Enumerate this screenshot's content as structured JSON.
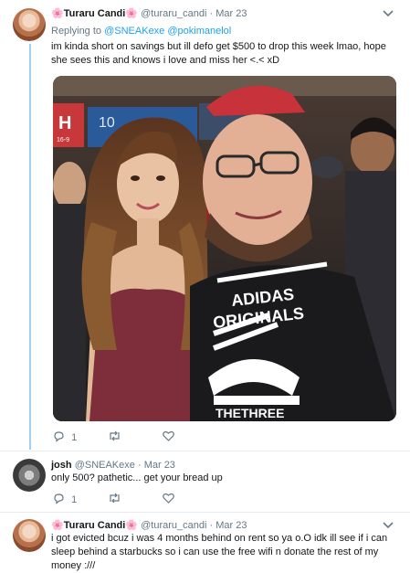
{
  "tweets": [
    {
      "name": "Turaru Candi",
      "emoji": "🌸",
      "handle": "@turaru_candi",
      "dot": "·",
      "time": "Mar 23",
      "replying_prefix": "Replying to",
      "replying_to": "@SNEAKexe @pokimanelol",
      "text": "im kinda short on savings but ill defo get $500 to drop this week lmao, hope she sees this and knows i love and miss her <.< xD",
      "replies": "1",
      "retweets": "",
      "likes": ""
    },
    {
      "name": "josh",
      "handle": "@SNEAKexe",
      "dot": "·",
      "time": "Mar 23",
      "text": "only 500? pathetic... get your bread up",
      "replies": "1",
      "retweets": "",
      "likes": ""
    },
    {
      "name": "Turaru Candi",
      "emoji": "🌸",
      "handle": "@turaru_candi",
      "dot": "·",
      "time": "Mar 23",
      "text": "i got evicted bcuz i was 4 months behind on rent so ya o.O idk ill see if i can sleep behind a starbucks so i can use the free wifi n donate the rest of my money :///"
    }
  ],
  "photo": {
    "sign_h": "H",
    "sign_h_sub": "16-9",
    "sign_10": "10",
    "shirt_line1": "ADIDAS",
    "shirt_line2": "ORIGINALS",
    "shirt_line3": "THETHREE"
  },
  "icons": {
    "reply": "reply-icon",
    "retweet": "retweet-icon",
    "like": "heart-icon",
    "menu": "chevron-down-icon"
  },
  "colors": {
    "link": "#1da1f2",
    "thread": "#9fd0f3",
    "muted": "#657786"
  }
}
